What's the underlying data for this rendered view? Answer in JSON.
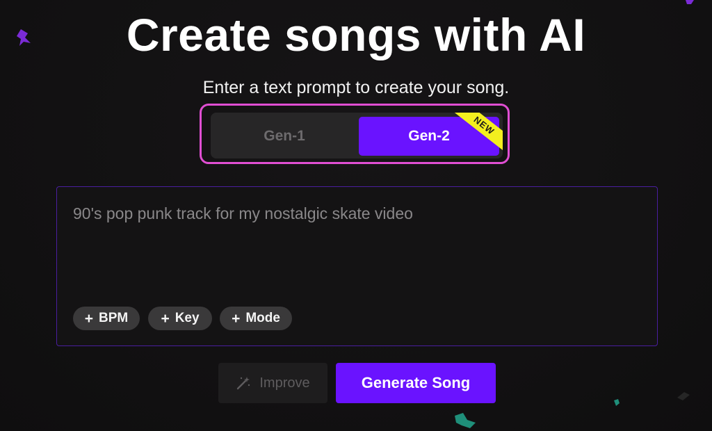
{
  "header": {
    "title": "Create songs with AI",
    "subtitle": "Enter a text prompt to create your song."
  },
  "model_toggle": {
    "options": [
      {
        "label": "Gen-1",
        "selected": false
      },
      {
        "label": "Gen-2",
        "selected": true
      }
    ],
    "new_badge": "NEW"
  },
  "prompt": {
    "placeholder": "90's pop punk track for my nostalgic skate video",
    "chips": [
      {
        "label": "BPM",
        "icon": "plus-icon"
      },
      {
        "label": "Key",
        "icon": "plus-icon"
      },
      {
        "label": "Mode",
        "icon": "plus-icon"
      }
    ]
  },
  "actions": {
    "improve_label": "Improve",
    "improve_icon": "magic-wand-icon",
    "generate_label": "Generate Song"
  },
  "colors": {
    "background": "#121112",
    "accent": "#6a13ff",
    "highlight_border": "#e14ed3",
    "badge": "#f3ef1f"
  }
}
